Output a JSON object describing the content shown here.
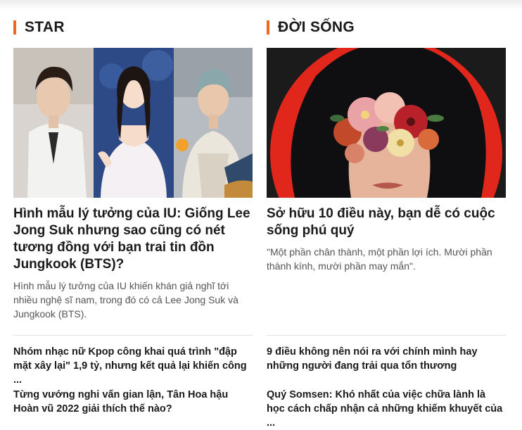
{
  "left": {
    "section_title": "STAR",
    "headline": "Hình mẫu lý tưởng của IU: Giống Lee Jong Suk nhưng sao cũng có nét tương đồng với bạn trai tin đồn Jungkook (BTS)?",
    "sapo": "Hình mẫu lý tưởng của IU khiến khán giả nghĩ tới nhiều nghệ sĩ nam, trong đó có cả Lee Jong Suk và Jungkook (BTS).",
    "related": [
      "Nhóm nhạc nữ Kpop công khai quá trình \"đập mặt xây lại\" 1,9 tỷ, nhưng kết quả lại khiến công ...",
      "Từng vướng nghi vấn gian lận, Tân Hoa hậu Hoàn vũ 2022 giải thích thế nào?"
    ]
  },
  "right": {
    "section_title": "ĐỜI SỐNG",
    "headline": "Sở hữu 10 điều này, bạn dễ có cuộc sống phú quý",
    "sapo": "\"Một phần chân thành, một phần lợi ích. Mười phần thành kính, mười phần may mắn\".",
    "related": [
      "9 điều không nên nói ra với chính mình hay những người đang trải qua tổn thương",
      "Quý Somsen: Khó nhất của việc chữa lành là học cách chấp nhận cả những khiếm khuyết của ..."
    ]
  },
  "colors": {
    "accent": "#f26522",
    "text": "#1a1a1a",
    "muted": "#555555",
    "divider": "#e2e2e2"
  }
}
